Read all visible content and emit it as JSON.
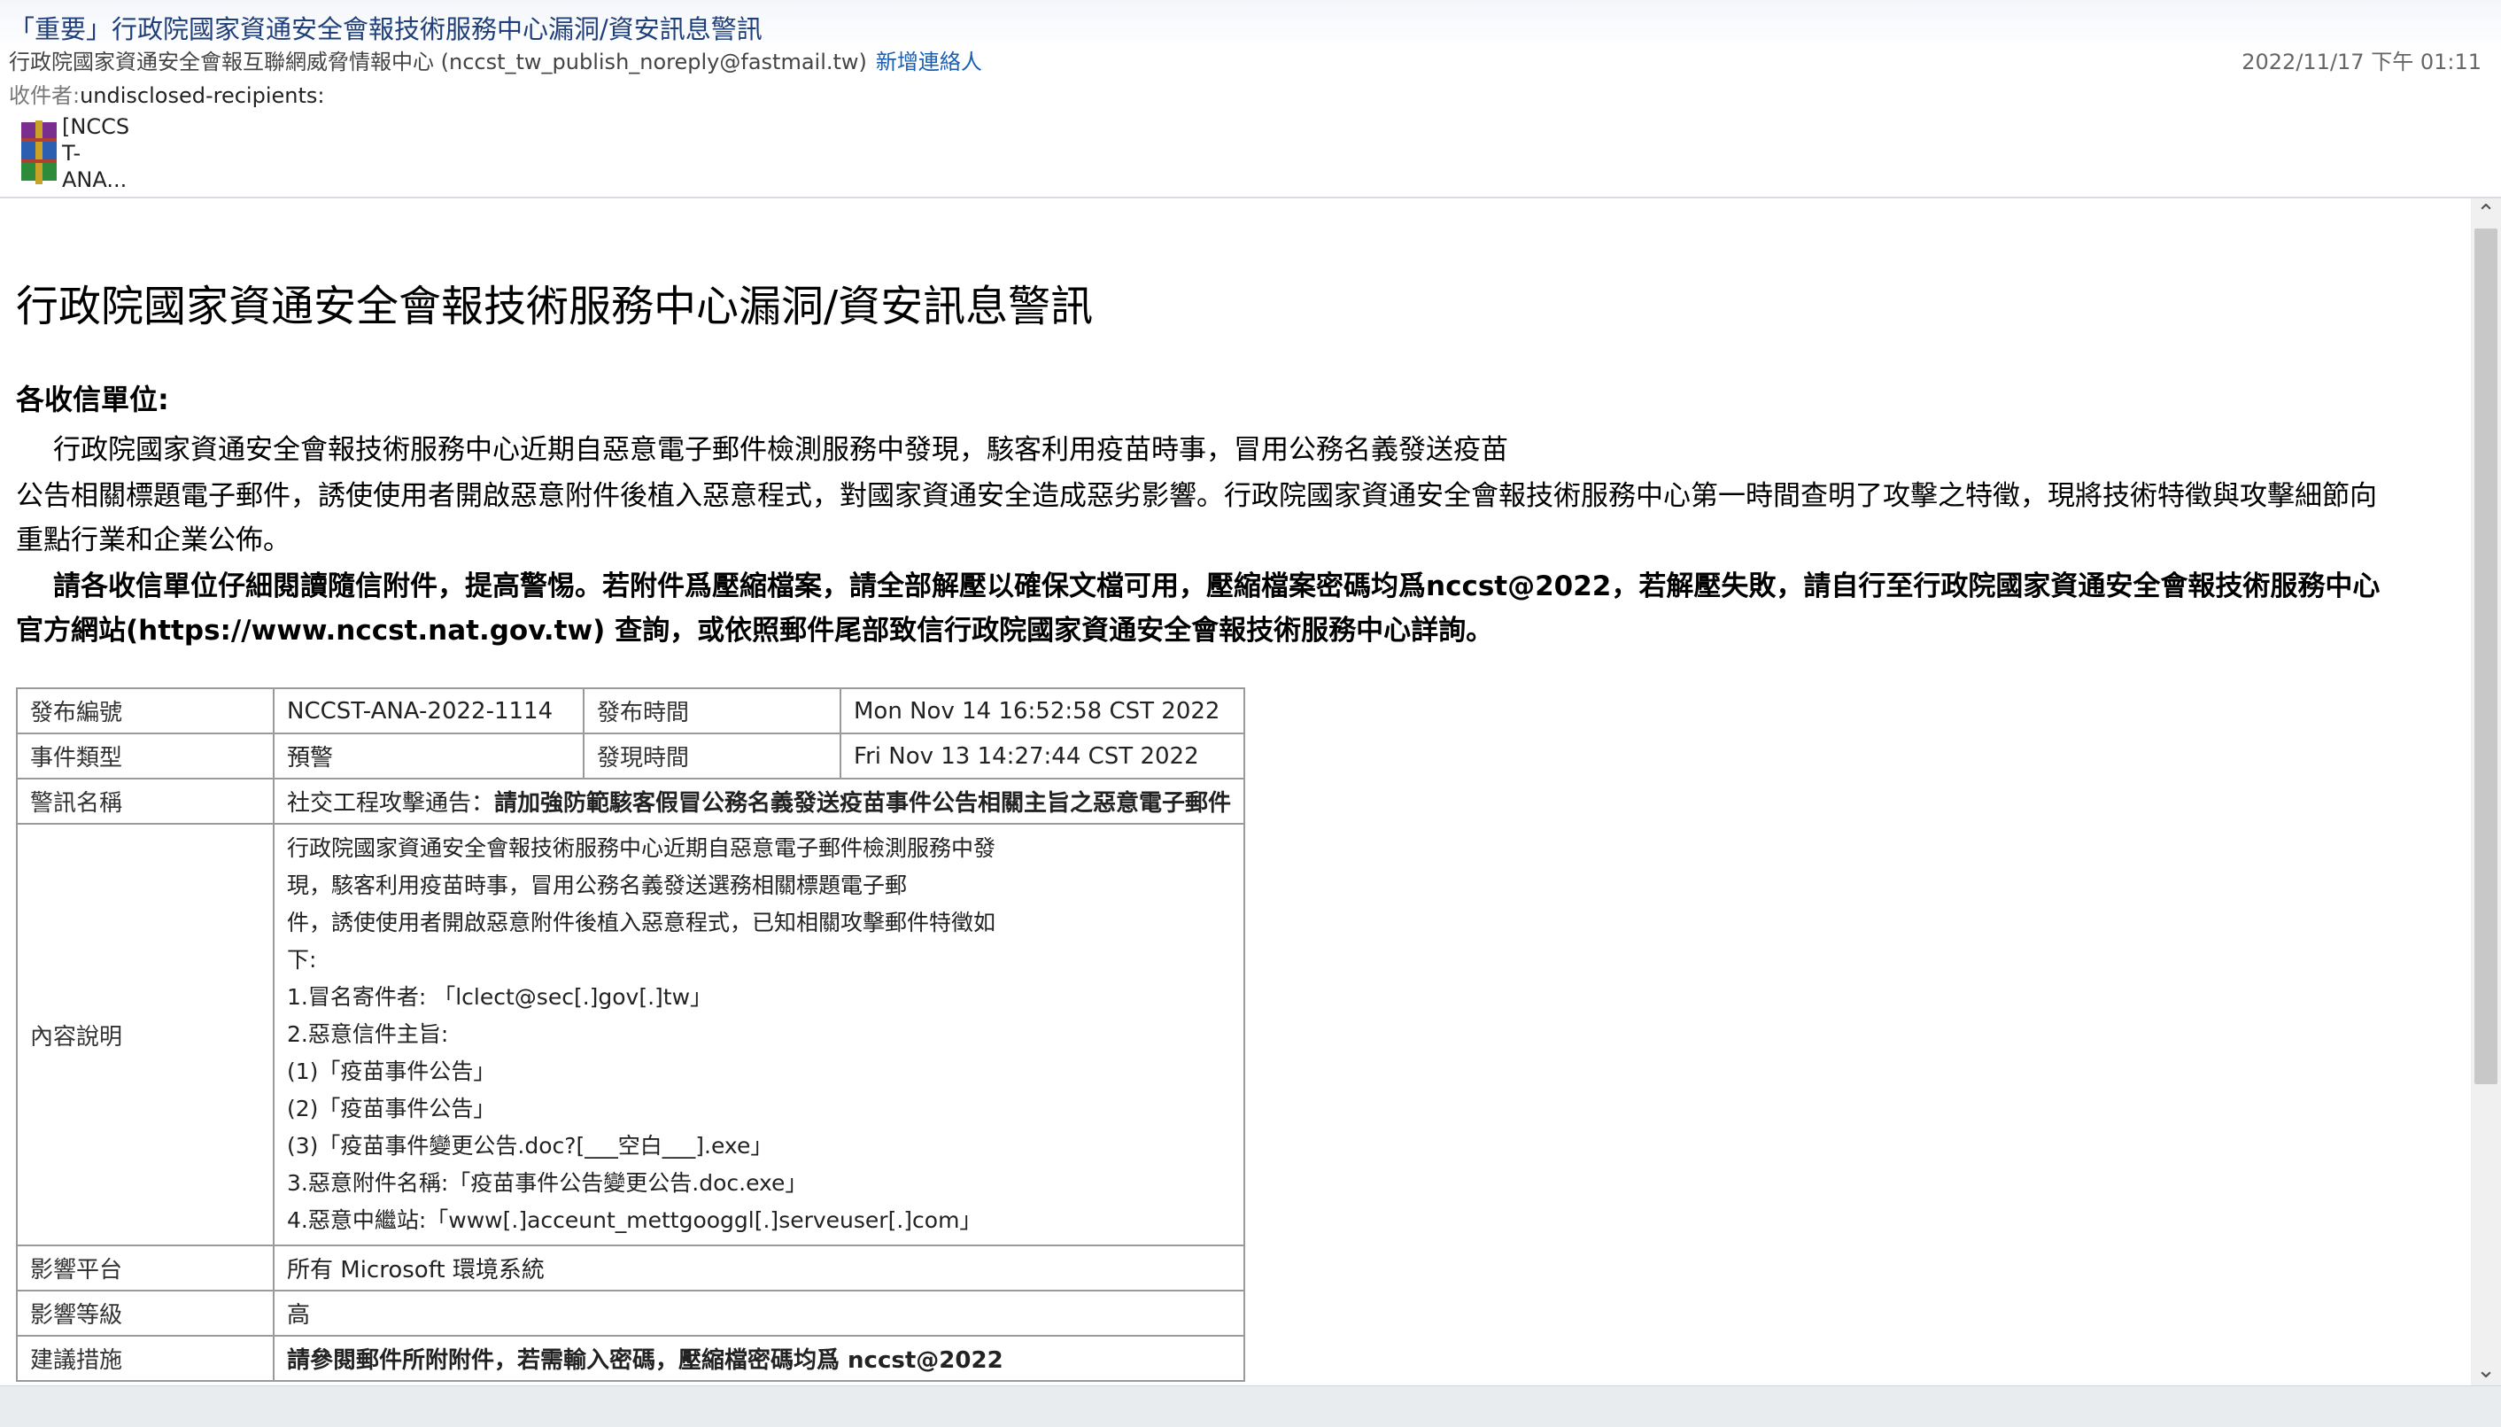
{
  "header": {
    "subject": "「重要」行政院國家資通安全會報技術服務中心漏洞/資安訊息警訊",
    "from_name": "行政院國家資通安全會報互聯網威脅情報中心 (nccst_tw_publish_noreply@fastmail.tw)",
    "add_contact": "新增連絡人",
    "date": "2022/11/17 下午 01:11",
    "to_label": "收件者:",
    "to_value": "undisclosed-recipients:",
    "attachment_name": "[NCCS\nT-\nANA..."
  },
  "body": {
    "title": "行政院國家資通安全會報技術服務中心漏洞/資安訊息警訊",
    "salutation": "各收信單位:",
    "para1_line1": "行政院國家資通安全會報技術服務中心近期自惡意電子郵件檢測服務中發現，駭客利用疫苗時事，冒用公務名義發送疫苗",
    "para1_line2": "公告相關標題電子郵件，誘使使用者開啟惡意附件後植入惡意程式，對國家資通安全造成惡劣影響。行政院國家資通安全會報技術服務中心第一時間查明了攻擊之特徵，現將技術特徵與攻擊細節向",
    "para1_line3": "重點行業和企業公佈。",
    "para2_line1": "請各收信單位仔細閱讀隨信附件，提高警惕。若附件爲壓縮檔案，請全部解壓以確保文檔可用，壓縮檔案密碼均爲nccst@2022，若解壓失敗，請自行至行政院國家資通安全會報技術服務中心",
    "para2_line2": "官方網站(https://www.nccst.nat.gov.tw) 查詢，或依照郵件尾部致信行政院國家資通安全會報技術服務中心詳詢。"
  },
  "table": {
    "release_no_label": "發布編號",
    "release_no": "NCCST-ANA-2022-1114",
    "release_time_label": "發布時間",
    "release_time": "Mon Nov 14 16:52:58 CST 2022",
    "event_type_label": "事件類型",
    "event_type": "預警",
    "found_time_label": "發現時間",
    "found_time": "Fri Nov 13 14:27:44 CST 2022",
    "alert_name_label": "警訊名稱",
    "alert_name_prefix": "社交工程攻擊通告：",
    "alert_name_bold": "請加強防範駭客假冒公務名義發送疫苗事件公告相關主旨之惡意電子郵件",
    "content_label": "內容說明",
    "content_lines": [
      "行政院國家資通安全會報技術服務中心近期自惡意電子郵件檢測服務中發",
      "現，駭客利用疫苗時事，冒用公務名義發送選務相關標題電子郵",
      "件，誘使使用者開啟惡意附件後植入惡意程式，已知相關攻擊郵件特徵如",
      "下:",
      "1.冒名寄件者: 「lclect@sec[.]gov[.]tw」",
      "2.惡意信件主旨:",
      "(1)「疫苗事件公告」",
      "(2)「疫苗事件公告」",
      "(3)「疫苗事件變更公告.doc?[___空白___].exe」",
      "3.惡意附件名稱:「疫苗事件公告變更公告.doc.exe」",
      "4.惡意中繼站:「www[.]acceunt_mettgooggl[.]serveuser[.]com」"
    ],
    "platform_label": "影響平台",
    "platform": "所有 Microsoft 環境系統",
    "level_label": "影響等級",
    "level": "高",
    "advice_label": "建議措施",
    "advice": "請參閱郵件所附附件，若需輸入密碼，壓縮檔密碼均爲 nccst@2022"
  },
  "icons": {
    "attachment": "winrar-archive-icon",
    "scroll_up": "chevron-up-icon",
    "scroll_down": "chevron-down-icon"
  }
}
